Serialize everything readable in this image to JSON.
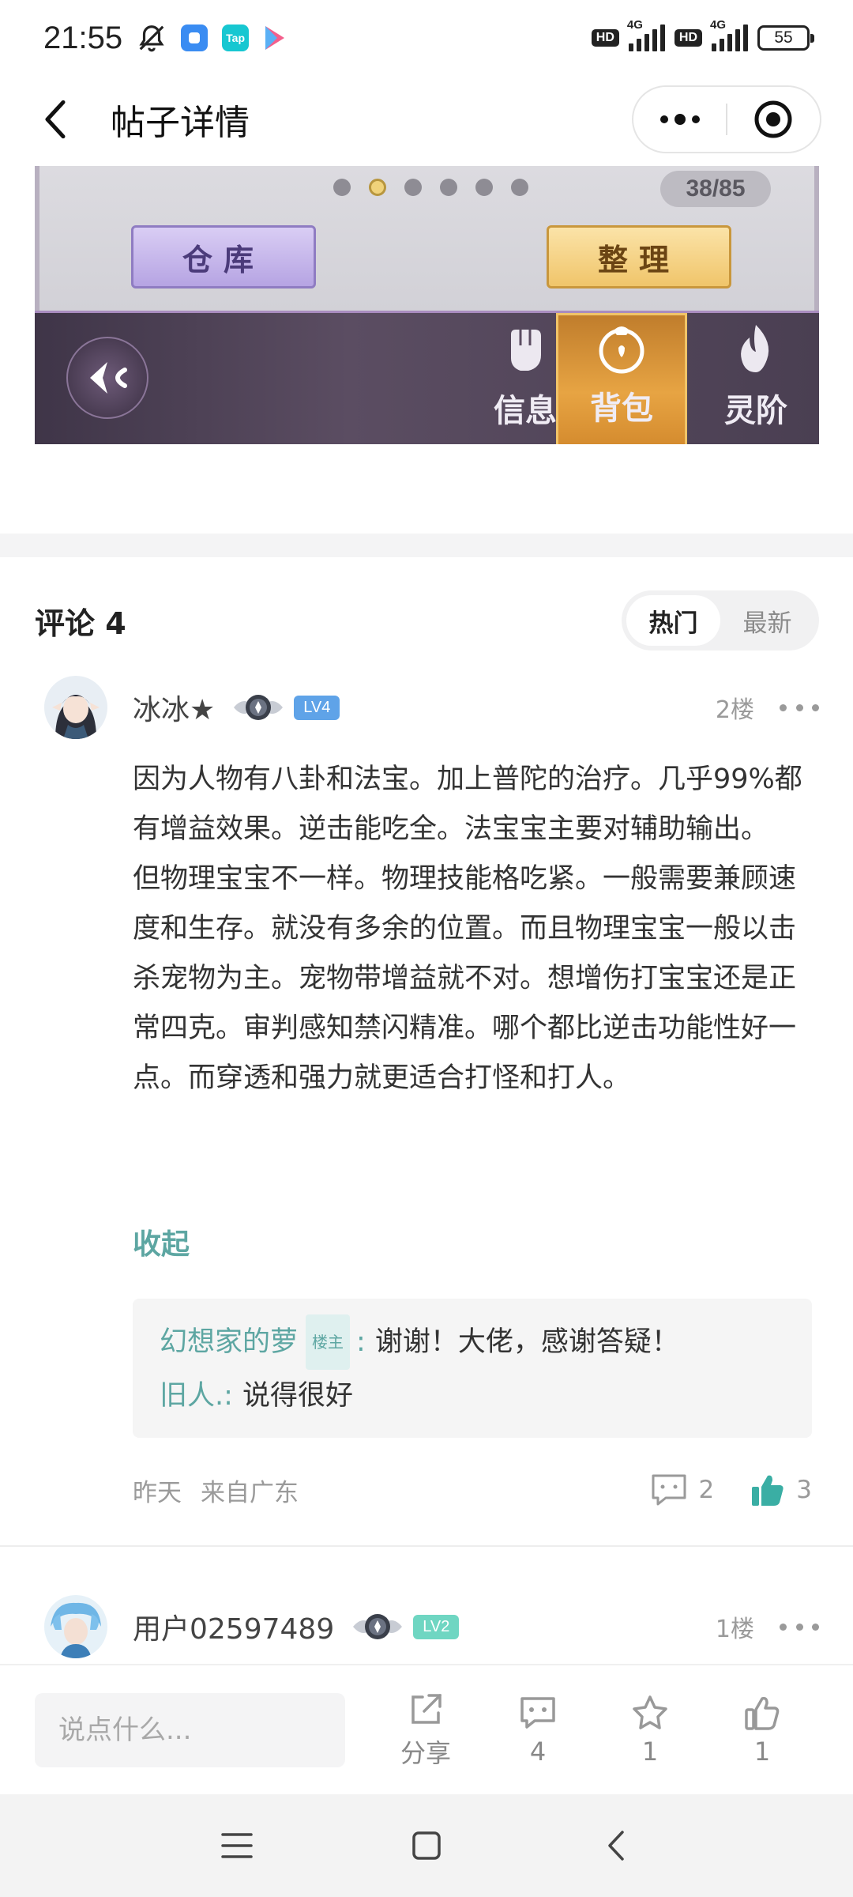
{
  "status_bar": {
    "time": "21:55",
    "network_1": "4G",
    "network_2": "4G",
    "hd_1": "HD",
    "hd_2": "HD",
    "battery": "55",
    "tap_label": "Tap"
  },
  "nav": {
    "title": "帖子详情"
  },
  "game_image": {
    "page_counter": "38/85",
    "warehouse_label": "仓库",
    "sort_label": "整理",
    "tabs": [
      {
        "label": "信息",
        "active": false
      },
      {
        "label": "背包",
        "active": true
      },
      {
        "label": "灵阶",
        "active": false
      }
    ],
    "dots_total": 6,
    "dot_active_index": 1
  },
  "comments_section": {
    "title": "评论 4",
    "sort_hot": "热门",
    "sort_new": "最新"
  },
  "comments": [
    {
      "user": "冰冰★",
      "level": "LV4",
      "floor": "2楼",
      "paragraphs": [
        "因为人物有八卦和法宝。加上普陀的治疗。几乎99%都有增益效果。逆击能吃全。法宝宝主要对辅助输出。",
        "但物理宝宝不一样。物理技能格吃紧。一般需要兼顾速度和生存。就没有多余的位置。而且物理宝宝一般以击杀宠物为主。宠物带增益就不对。想增伤打宝宝还是正常四克。审判感知禁闪精准。哪个都比逆击功能性好一点。而穿透和强力就更适合打怪和打人。"
      ],
      "collapse_label": "收起",
      "replies": [
        {
          "author": "幻想家的萝",
          "tag": "楼主",
          "colon": ":",
          "text": "谢谢！大佬，感谢答疑！"
        },
        {
          "author": "旧人.",
          "colon": ":",
          "text": "说得很好"
        }
      ],
      "time": "昨天",
      "location": "来自广东",
      "reply_count": "2",
      "like_count": "3"
    },
    {
      "user": "用户02597489",
      "level": "LV2",
      "floor": "1楼"
    }
  ],
  "bottom_bar": {
    "input_placeholder": "说点什么...",
    "share_label": "分享",
    "comment_count": "4",
    "star_count": "1",
    "like_count": "1"
  },
  "colors": {
    "accent": "#5da6a2",
    "lv4_badge": "#5fa3e8",
    "lv2_badge": "#6fd6c2"
  }
}
